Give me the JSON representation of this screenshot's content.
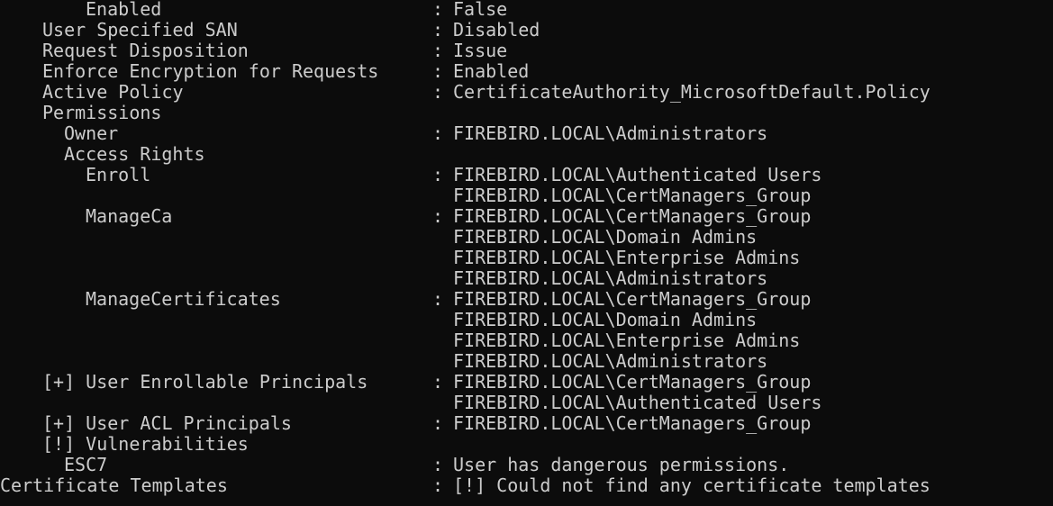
{
  "terminal": {
    "separator": ":",
    "lines": [
      {
        "indent": 3,
        "key": "Enabled",
        "value": "False"
      },
      {
        "indent": 1,
        "key": "User Specified SAN",
        "value": "Disabled"
      },
      {
        "indent": 1,
        "key": "Request Disposition",
        "value": "Issue"
      },
      {
        "indent": 1,
        "key": "Enforce Encryption for Requests",
        "value": "Enabled"
      },
      {
        "indent": 1,
        "key": "Active Policy",
        "value": "CertificateAuthority_MicrosoftDefault.Policy"
      },
      {
        "indent": 1,
        "key": "Permissions",
        "value": ""
      },
      {
        "indent": 2,
        "key": "Owner",
        "value": "FIREBIRD.LOCAL\\Administrators"
      },
      {
        "indent": 2,
        "key": "Access Rights",
        "value": ""
      },
      {
        "indent": 3,
        "key": "Enroll",
        "value": "FIREBIRD.LOCAL\\Authenticated Users"
      },
      {
        "indent": 3,
        "key": "",
        "value": "FIREBIRD.LOCAL\\CertManagers_Group"
      },
      {
        "indent": 3,
        "key": "ManageCa",
        "value": "FIREBIRD.LOCAL\\CertManagers_Group"
      },
      {
        "indent": 3,
        "key": "",
        "value": "FIREBIRD.LOCAL\\Domain Admins"
      },
      {
        "indent": 3,
        "key": "",
        "value": "FIREBIRD.LOCAL\\Enterprise Admins"
      },
      {
        "indent": 3,
        "key": "",
        "value": "FIREBIRD.LOCAL\\Administrators"
      },
      {
        "indent": 3,
        "key": "ManageCertificates",
        "value": "FIREBIRD.LOCAL\\CertManagers_Group"
      },
      {
        "indent": 3,
        "key": "",
        "value": "FIREBIRD.LOCAL\\Domain Admins"
      },
      {
        "indent": 3,
        "key": "",
        "value": "FIREBIRD.LOCAL\\Enterprise Admins"
      },
      {
        "indent": 3,
        "key": "",
        "value": "FIREBIRD.LOCAL\\Administrators"
      },
      {
        "indent": 1,
        "key": "[+] User Enrollable Principals",
        "value": "FIREBIRD.LOCAL\\CertManagers_Group"
      },
      {
        "indent": 1,
        "key": "",
        "value": "FIREBIRD.LOCAL\\Authenticated Users"
      },
      {
        "indent": 1,
        "key": "[+] User ACL Principals",
        "value": "FIREBIRD.LOCAL\\CertManagers_Group"
      },
      {
        "indent": 1,
        "key": "[!] Vulnerabilities",
        "value": ""
      },
      {
        "indent": 2,
        "key": "ESC7",
        "value": "User has dangerous permissions."
      },
      {
        "indent": 0,
        "key": "Certificate Templates",
        "value": "[!] Could not find any certificate templates"
      }
    ]
  },
  "colors": {
    "background": "#0c0c0c",
    "foreground": "#cccccc"
  }
}
